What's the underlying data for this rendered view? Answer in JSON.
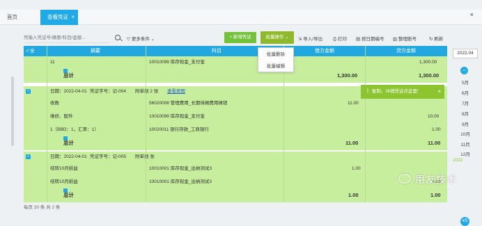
{
  "tabs": {
    "home": "首页",
    "active": "查看凭证",
    "close": "×"
  },
  "window_close": "×",
  "toolbar": {
    "search_placeholder": "凭输入凭证号/摘要/科目/金额...",
    "more_conditions": "更多条件",
    "new_voucher": "+ 新增凭证",
    "batch_ops": "批量操作",
    "import_export": "导入/导出",
    "print": "打印",
    "sort_by_date": "按日期编号",
    "reorder": "整理断号",
    "refresh": "刷新"
  },
  "batch_menu": {
    "items": [
      "批量删除",
      "批量编辑"
    ]
  },
  "grid_header": {
    "select_all": "全选",
    "summary": "摘要",
    "subject": "科目",
    "debit": "借方金额",
    "credit": "贷方金额"
  },
  "rows": {
    "r0": {
      "summary": "11",
      "subject": "10010099 库存现金_支付宝",
      "credit": "1,300.00"
    },
    "total1": {
      "label": "总计",
      "debit": "1,300.00",
      "credit": "1,300.00"
    },
    "v2": {
      "date": "日期：2022-04-01",
      "voucher": "凭证字号：记-004",
      "attach": "附单据 2 张",
      "link": "查看原图"
    },
    "r1": {
      "summary": "收数",
      "subject": "56020008 管理费用_长期待摊费用摊销",
      "debit": "11.00"
    },
    "r2": {
      "summary": "维修、配件",
      "subject": "10010099 库存现金_支付宝",
      "credit": "10.00"
    },
    "r3": {
      "summary": "1（BBD：1，汇率：1）",
      "subject": "10020011 银行存款_工商银行",
      "credit": "1.00"
    },
    "total2": {
      "label": "总计",
      "debit": "11.00",
      "credit": "11.00"
    },
    "v3": {
      "date": "日期：2022-04-01",
      "voucher": "凭证字号：记-005",
      "attach": "附单据  张"
    },
    "r4": {
      "summary": "结转10月损益",
      "subject": "10010001 库存现金_出纳测试3",
      "debit": "1.00"
    },
    "r5": {
      "summary": "结转10月损益",
      "subject": "10010001 库存现金_出纳测试3",
      "credit": "1.00"
    },
    "total3": {
      "label": "总计",
      "debit": "1.00",
      "credit": "1.00"
    }
  },
  "toast": {
    "text": "复制、冲销凭证点这里!",
    "close": "×"
  },
  "datebar": {
    "top": "2022.04",
    "months": [
      "5月",
      "6月",
      "7月",
      "8月",
      "9月",
      "10月",
      "11月",
      "12月"
    ],
    "year": "2022",
    "current": "4月"
  },
  "footer": {
    "text": "每页  20    条  共 2 条"
  },
  "watermark": "用友技术"
}
